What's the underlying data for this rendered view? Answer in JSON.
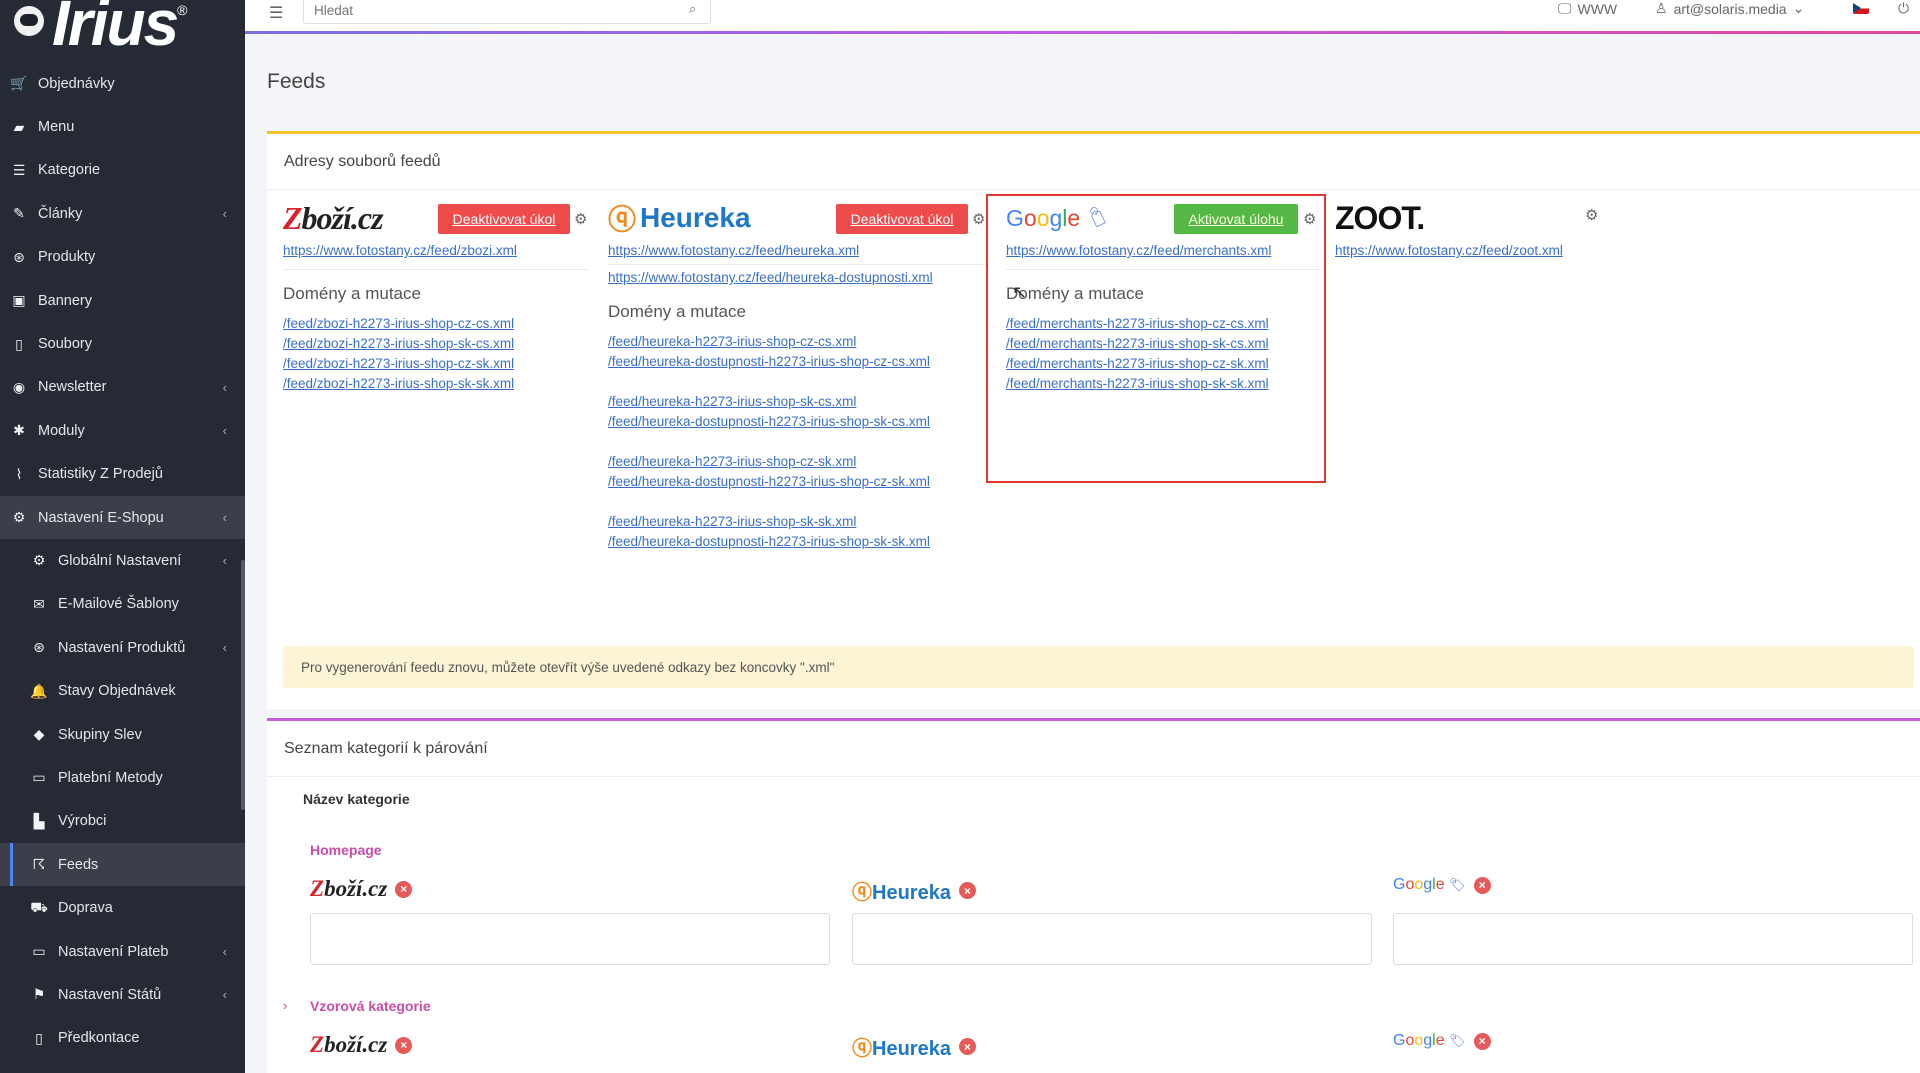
{
  "sidebar": {
    "logo_text": "Irius",
    "logo_reg": "®",
    "items": [
      {
        "label": "Objednávky",
        "icon": "cart-icon",
        "chevron": false
      },
      {
        "label": "Menu",
        "icon": "folder-icon",
        "chevron": false
      },
      {
        "label": "Kategorie",
        "icon": "list-icon",
        "chevron": false
      },
      {
        "label": "Články",
        "icon": "pencil-icon",
        "chevron": true
      },
      {
        "label": "Produkty",
        "icon": "aperture-icon",
        "chevron": false
      },
      {
        "label": "Bannery",
        "icon": "image-icon",
        "chevron": false
      },
      {
        "label": "Soubory",
        "icon": "file-icon",
        "chevron": false
      },
      {
        "label": "Newsletter",
        "icon": "mail-circle-icon",
        "chevron": true
      },
      {
        "label": "Moduly",
        "icon": "puzzle-icon",
        "chevron": true
      },
      {
        "label": "Statistiky Z Prodejů",
        "icon": "chart-icon",
        "chevron": false
      },
      {
        "label": "Nastavení E-Shopu",
        "icon": "cogs-icon",
        "chevron": true
      }
    ],
    "sub_items": [
      {
        "label": "Globální Nastavení",
        "icon": "gear-icon",
        "chevron": true
      },
      {
        "label": "E-Mailové Šablony",
        "icon": "envelope-icon",
        "chevron": false
      },
      {
        "label": "Nastavení Produktů",
        "icon": "aperture-icon",
        "chevron": true
      },
      {
        "label": "Stavy Objednávek",
        "icon": "bell-icon",
        "chevron": false
      },
      {
        "label": "Skupiny Slev",
        "icon": "tag-icon",
        "chevron": false
      },
      {
        "label": "Platební Metody",
        "icon": "card-icon",
        "chevron": false
      },
      {
        "label": "Výrobci",
        "icon": "factory-icon",
        "chevron": false
      },
      {
        "label": "Feeds",
        "icon": "rss-icon",
        "chevron": false,
        "active": true
      },
      {
        "label": "Doprava",
        "icon": "truck-icon",
        "chevron": false
      },
      {
        "label": "Nastavení Plateb",
        "icon": "card-icon",
        "chevron": true
      },
      {
        "label": "Nastavení Států",
        "icon": "flag-icon",
        "chevron": true
      },
      {
        "label": "Předkontace",
        "icon": "file-icon",
        "chevron": false
      }
    ]
  },
  "topbar": {
    "search_placeholder": "Hledat",
    "www_label": "WWW",
    "user_label": "art@solaris.media"
  },
  "page": {
    "title": "Feeds"
  },
  "feeds_card": {
    "title": "Adresy souborů feedů",
    "zbozi": {
      "logo": "zboží.cz",
      "button": "Deaktivovat úkol",
      "urls": [
        "https://www.fotostany.cz/feed/zbozi.xml"
      ],
      "section_title": "Domény a mutace",
      "domains": [
        "/feed/zbozi-h2273-irius-shop-cz-cs.xml",
        "/feed/zbozi-h2273-irius-shop-sk-cs.xml",
        "/feed/zbozi-h2273-irius-shop-cz-sk.xml",
        "/feed/zbozi-h2273-irius-shop-sk-sk.xml"
      ]
    },
    "heureka": {
      "logo": "Heureka",
      "button": "Deaktivovat úkol",
      "urls": [
        "https://www.fotostany.cz/feed/heureka.xml",
        "https://www.fotostany.cz/feed/heureka-dostupnosti.xml"
      ],
      "section_title": "Domény a mutace",
      "domains": [
        [
          "/feed/heureka-h2273-irius-shop-cz-cs.xml",
          "/feed/heureka-dostupnosti-h2273-irius-shop-cz-cs.xml"
        ],
        [
          "/feed/heureka-h2273-irius-shop-sk-cs.xml",
          "/feed/heureka-dostupnosti-h2273-irius-shop-sk-cs.xml"
        ],
        [
          "/feed/heureka-h2273-irius-shop-cz-sk.xml",
          "/feed/heureka-dostupnosti-h2273-irius-shop-cz-sk.xml"
        ],
        [
          "/feed/heureka-h2273-irius-shop-sk-sk.xml",
          "/feed/heureka-dostupnosti-h2273-irius-shop-sk-sk.xml"
        ]
      ]
    },
    "google": {
      "logo": "Google",
      "button": "Aktivovat úlohu",
      "urls": [
        "https://www.fotostany.cz/feed/merchants.xml"
      ],
      "section_title": "Domény a mutace",
      "domains": [
        "/feed/merchants-h2273-irius-shop-cz-cs.xml",
        "/feed/merchants-h2273-irius-shop-sk-cs.xml",
        "/feed/merchants-h2273-irius-shop-cz-sk.xml",
        "/feed/merchants-h2273-irius-shop-sk-sk.xml"
      ]
    },
    "zoot": {
      "logo": "ZOOT.",
      "urls": [
        "https://www.fotostany.cz/feed/zoot.xml"
      ]
    },
    "info_text": "Pro vygenerování feedu znovu, můžete otevřít výše uvedené odkazy bez koncovky \".xml\""
  },
  "categories_card": {
    "title": "Seznam kategorií k párování",
    "column_header": "Název kategorie",
    "categories": [
      {
        "name": "Homepage"
      },
      {
        "name": "Vzorová kategorie"
      }
    ],
    "brands": {
      "zbozi": "zboží.cz",
      "heureka": "Heureka",
      "google": "Google"
    }
  },
  "colors": {
    "sidebar_bg": "#252a34",
    "link": "#3b6fc6",
    "deactivate": "#ee4b4b",
    "activate": "#54b944",
    "highlight_box": "#e0372b"
  }
}
